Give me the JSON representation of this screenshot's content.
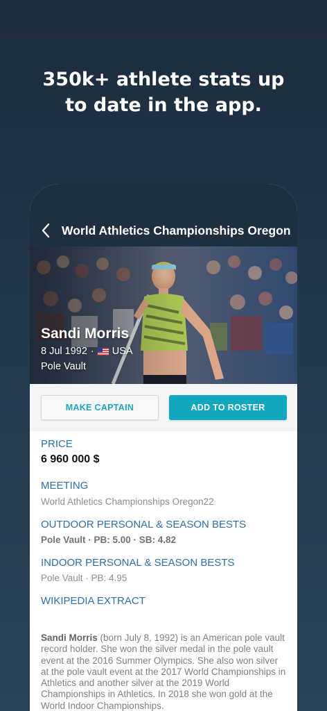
{
  "headline": {
    "line1": "350k+ athlete stats up",
    "line2": "to date in the app."
  },
  "nav": {
    "title": "World Athletics Championships Oregon..."
  },
  "athlete": {
    "name": "Sandi Morris",
    "birth_date": "8 Jul 1992",
    "separator": "·",
    "country": "USA",
    "event": "Pole Vault"
  },
  "actions": {
    "make_captain": "MAKE CAPTAIN",
    "add_to_roster": "ADD TO ROSTER"
  },
  "details": {
    "price_label": "PRICE",
    "price_value": "6 960 000 $",
    "meeting_label": "MEETING",
    "meeting_value": "World Athletics Championships Oregon22",
    "outdoor_label": "OUTDOOR PERSONAL & SEASON BESTS",
    "outdoor_value": "Pole Vault · PB: 5.00 · SB: 4.82",
    "indoor_label": "INDOOR PERSONAL & SEASON BESTS",
    "indoor_value": "Pole Vault · PB: 4.95",
    "wiki_label": "WIKIPEDIA EXTRACT",
    "wiki_name": "Sandi Morris",
    "wiki_text": " (born July 8, 1992) is an American pole vault record holder. She won the silver medal in the pole vault event at the 2016 Summer Olympics. She also won silver at the pole vault event at the 2017 World Championships in Athletics and another silver at the 2019 World Championships in Athletics. In 2018 she won gold at the World Indoor Championships."
  },
  "icons": {
    "back": "chevron-left-icon",
    "flag": "us-flag-icon"
  },
  "colors": {
    "accent": "#11a7bf",
    "label_blue": "#2f6ea6",
    "navbar": "#1e2f3f"
  }
}
